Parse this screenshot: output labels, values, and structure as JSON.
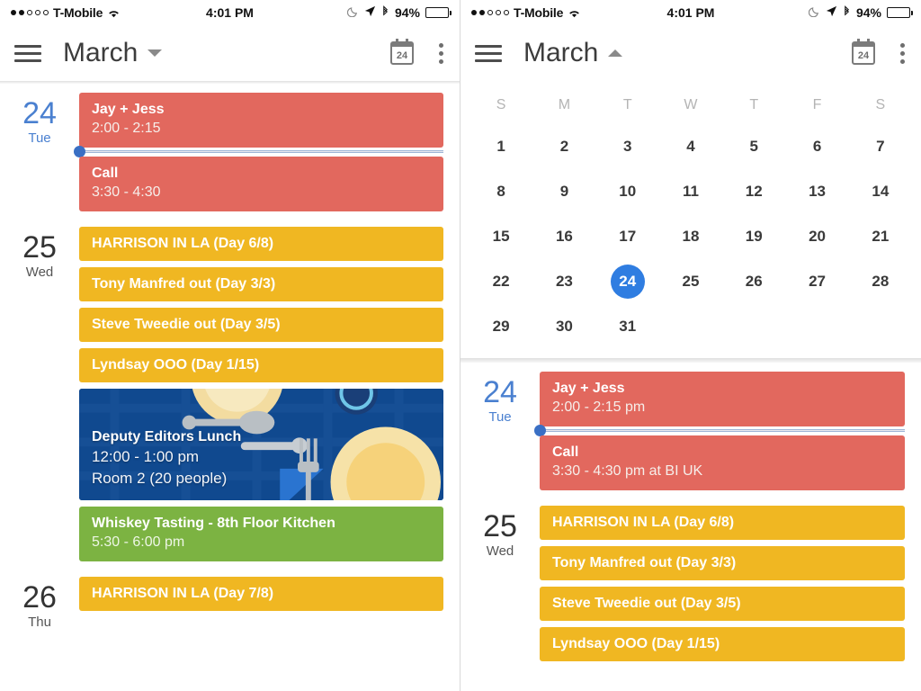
{
  "status_bar": {
    "signal_dots_filled": 2,
    "signal_dots_total": 5,
    "carrier": "T-Mobile",
    "wifi_icon": "wifi-icon",
    "time": "4:01 PM",
    "dnd_icon": "moon-icon",
    "location_icon": "location-arrow-icon",
    "bluetooth_icon": "bluetooth-icon",
    "battery_percent": "94%",
    "battery_level": 94
  },
  "app_bar": {
    "menu_icon": "hamburger-icon",
    "title": "March",
    "chevron_left": "chevron-down-icon",
    "chevron_right": "chevron-up-icon",
    "today_icon_label": "24",
    "overflow_icon": "kebab-menu-icon"
  },
  "month_grid": {
    "weekday_headers": [
      "S",
      "M",
      "T",
      "W",
      "T",
      "F",
      "S"
    ],
    "weeks": [
      [
        "1",
        "2",
        "3",
        "4",
        "5",
        "6",
        "7"
      ],
      [
        "8",
        "9",
        "10",
        "11",
        "12",
        "13",
        "14"
      ],
      [
        "15",
        "16",
        "17",
        "18",
        "19",
        "20",
        "21"
      ],
      [
        "22",
        "23",
        "24",
        "25",
        "26",
        "27",
        "28"
      ],
      [
        "29",
        "30",
        "31",
        "",
        "",
        "",
        ""
      ]
    ],
    "selected_day": "24",
    "selected_color": "#2f7de1"
  },
  "colors": {
    "red_event": "#e2685e",
    "yellow_event": "#f0b722",
    "green_event": "#7cb342",
    "blue_card": "#10498f",
    "today_blue": "#4a80d0"
  },
  "left_panel": {
    "days": [
      {
        "day_num": "24",
        "day_name": "Tue",
        "is_today": true,
        "events": [
          {
            "title": "Jay + Jess",
            "subtitle": "2:00 - 2:15",
            "color": "red",
            "type": "timed"
          },
          {
            "title": "Call",
            "subtitle": "3:30 - 4:30",
            "color": "red",
            "type": "timed"
          }
        ]
      },
      {
        "day_num": "25",
        "day_name": "Wed",
        "is_today": false,
        "events": [
          {
            "title": "HARRISON IN LA (Day 6/8)",
            "subtitle": "",
            "color": "yellow",
            "type": "allday"
          },
          {
            "title": "Tony Manfred out (Day 3/3)",
            "subtitle": "",
            "color": "yellow",
            "type": "allday"
          },
          {
            "title": "Steve Tweedie out (Day 3/5)",
            "subtitle": "",
            "color": "yellow",
            "type": "allday"
          },
          {
            "title": "Lyndsay OOO (Day 1/15)",
            "subtitle": "",
            "color": "yellow",
            "type": "allday"
          },
          {
            "title": "Deputy Editors Lunch",
            "subtitle": "12:00 - 1:00 pm",
            "subtitle2": "Room 2 (20 people)",
            "color": "blue-art",
            "type": "illustrated"
          },
          {
            "title": "Whiskey Tasting - 8th Floor Kitchen",
            "subtitle": "5:30 - 6:00 pm",
            "color": "green",
            "type": "timed"
          }
        ]
      },
      {
        "day_num": "26",
        "day_name": "Thu",
        "is_today": false,
        "events": [
          {
            "title": "HARRISON IN LA (Day 7/8)",
            "subtitle": "",
            "color": "yellow",
            "type": "allday"
          }
        ]
      }
    ]
  },
  "right_panel": {
    "days": [
      {
        "day_num": "24",
        "day_name": "Tue",
        "is_today": true,
        "events": [
          {
            "title": "Jay + Jess",
            "subtitle": "2:00 - 2:15 pm",
            "color": "red",
            "type": "timed"
          },
          {
            "title": "Call",
            "subtitle": "3:30 - 4:30 pm at BI UK",
            "color": "red",
            "type": "timed"
          }
        ]
      },
      {
        "day_num": "25",
        "day_name": "Wed",
        "is_today": false,
        "events": [
          {
            "title": "HARRISON IN LA (Day 6/8)",
            "subtitle": "",
            "color": "yellow",
            "type": "allday"
          },
          {
            "title": "Tony Manfred out (Day 3/3)",
            "subtitle": "",
            "color": "yellow",
            "type": "allday"
          },
          {
            "title": "Steve Tweedie out (Day 3/5)",
            "subtitle": "",
            "color": "yellow",
            "type": "allday"
          },
          {
            "title": "Lyndsay OOO (Day 1/15)",
            "subtitle": "",
            "color": "yellow",
            "type": "allday"
          }
        ]
      }
    ]
  }
}
